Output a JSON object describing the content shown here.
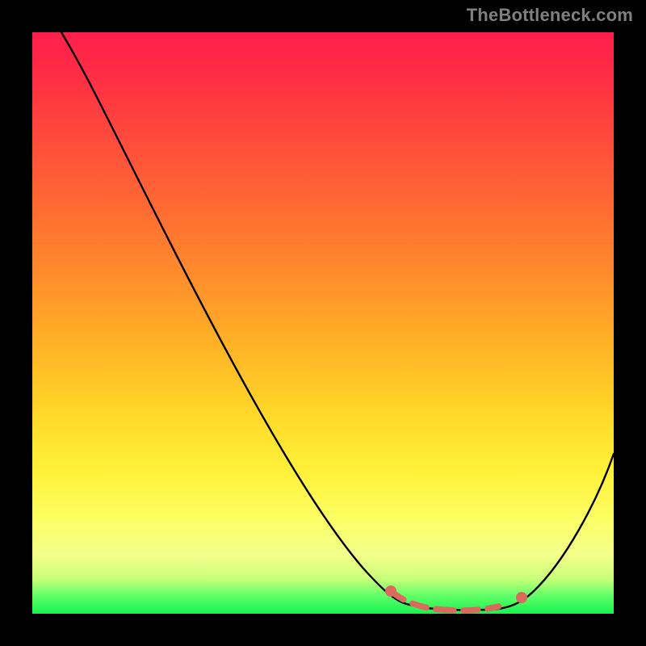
{
  "watermark": "TheBottleneck.com",
  "colors": {
    "frame": "#000000",
    "curve": "#000000",
    "marker": "#d96a5c"
  },
  "chart_data": {
    "type": "line",
    "title": "",
    "xlabel": "",
    "ylabel": "",
    "xlim": [
      0,
      100
    ],
    "ylim": [
      0,
      100
    ],
    "grid": false,
    "legend": false,
    "background": "gradient-red-to-green-vertical",
    "series": [
      {
        "name": "bottleneck-curve",
        "x": [
          5,
          10,
          15,
          20,
          25,
          30,
          35,
          40,
          45,
          50,
          55,
          60,
          62,
          64,
          68,
          72,
          76,
          80,
          84,
          88,
          92,
          96,
          100
        ],
        "y": [
          100,
          93,
          85,
          77,
          69,
          60,
          52,
          44,
          36,
          28,
          19,
          11,
          7,
          4,
          1,
          0,
          0,
          0,
          1,
          6,
          14,
          22,
          30
        ]
      }
    ],
    "optimum_band": {
      "x_start": 62,
      "x_end": 84,
      "y": 0
    },
    "annotations": []
  }
}
